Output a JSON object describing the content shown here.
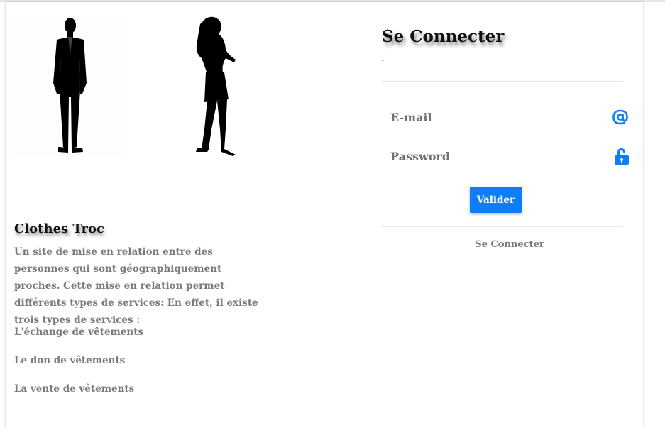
{
  "brand": {
    "title": "Clothes Troc",
    "description": "Un site de mise en relation entre des personnes qui sont géographiquement proches. Cette mise en relation permet différents types de services: En effet, il existe trois types de services :",
    "services": [
      "L'échange de vêtements",
      "Le don de vêtements",
      "La vente de vêtements"
    ]
  },
  "login": {
    "title": "Se Connecter",
    "subtitle": "-",
    "email_label": "E-mail",
    "password_label": "Password",
    "submit_label": "Valider",
    "footer_link": "Se Connecter"
  },
  "icons": {
    "email": "at-icon",
    "password": "unlock-icon"
  },
  "colors": {
    "accent": "#0d7dfa",
    "text_muted": "#7a7a7a",
    "heading": "#111111"
  }
}
